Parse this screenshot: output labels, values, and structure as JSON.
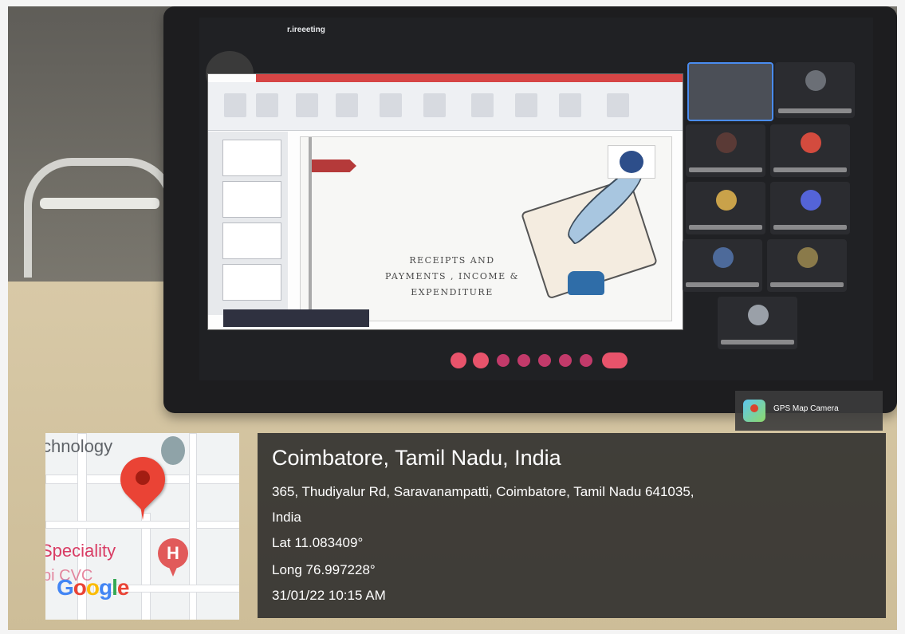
{
  "meeting": {
    "title": "r.ireeeting",
    "slide_text": "RECEIPTS AND\nPAYMENTS , INCOME &\nEXPENDITURE"
  },
  "overlay": {
    "app_label": "GPS Map Camera",
    "map": {
      "label_top": "chnology",
      "label_bottom": "Speciality",
      "label_cvc": "pi CVC",
      "google_letters": [
        {
          "ch": "G",
          "color": "#4285f4"
        },
        {
          "ch": "o",
          "color": "#ea4335"
        },
        {
          "ch": "o",
          "color": "#fbbc05"
        },
        {
          "ch": "g",
          "color": "#4285f4"
        },
        {
          "ch": "l",
          "color": "#34a853"
        },
        {
          "ch": "e",
          "color": "#ea4335"
        }
      ]
    },
    "location": {
      "city": "Coimbatore, Tamil Nadu, India",
      "address_line1": "365, Thudiyalur Rd, Saravanampatti, Coimbatore, Tamil Nadu 641035,",
      "address_line2": "India",
      "lat": "Lat 11.083409°",
      "long": "Long 76.997228°",
      "datetime": "31/01/22 10:15 AM"
    }
  },
  "colors": {
    "pin": "#ea4335",
    "hospital": "#e15a5a",
    "overlay_bg": "#282828"
  }
}
